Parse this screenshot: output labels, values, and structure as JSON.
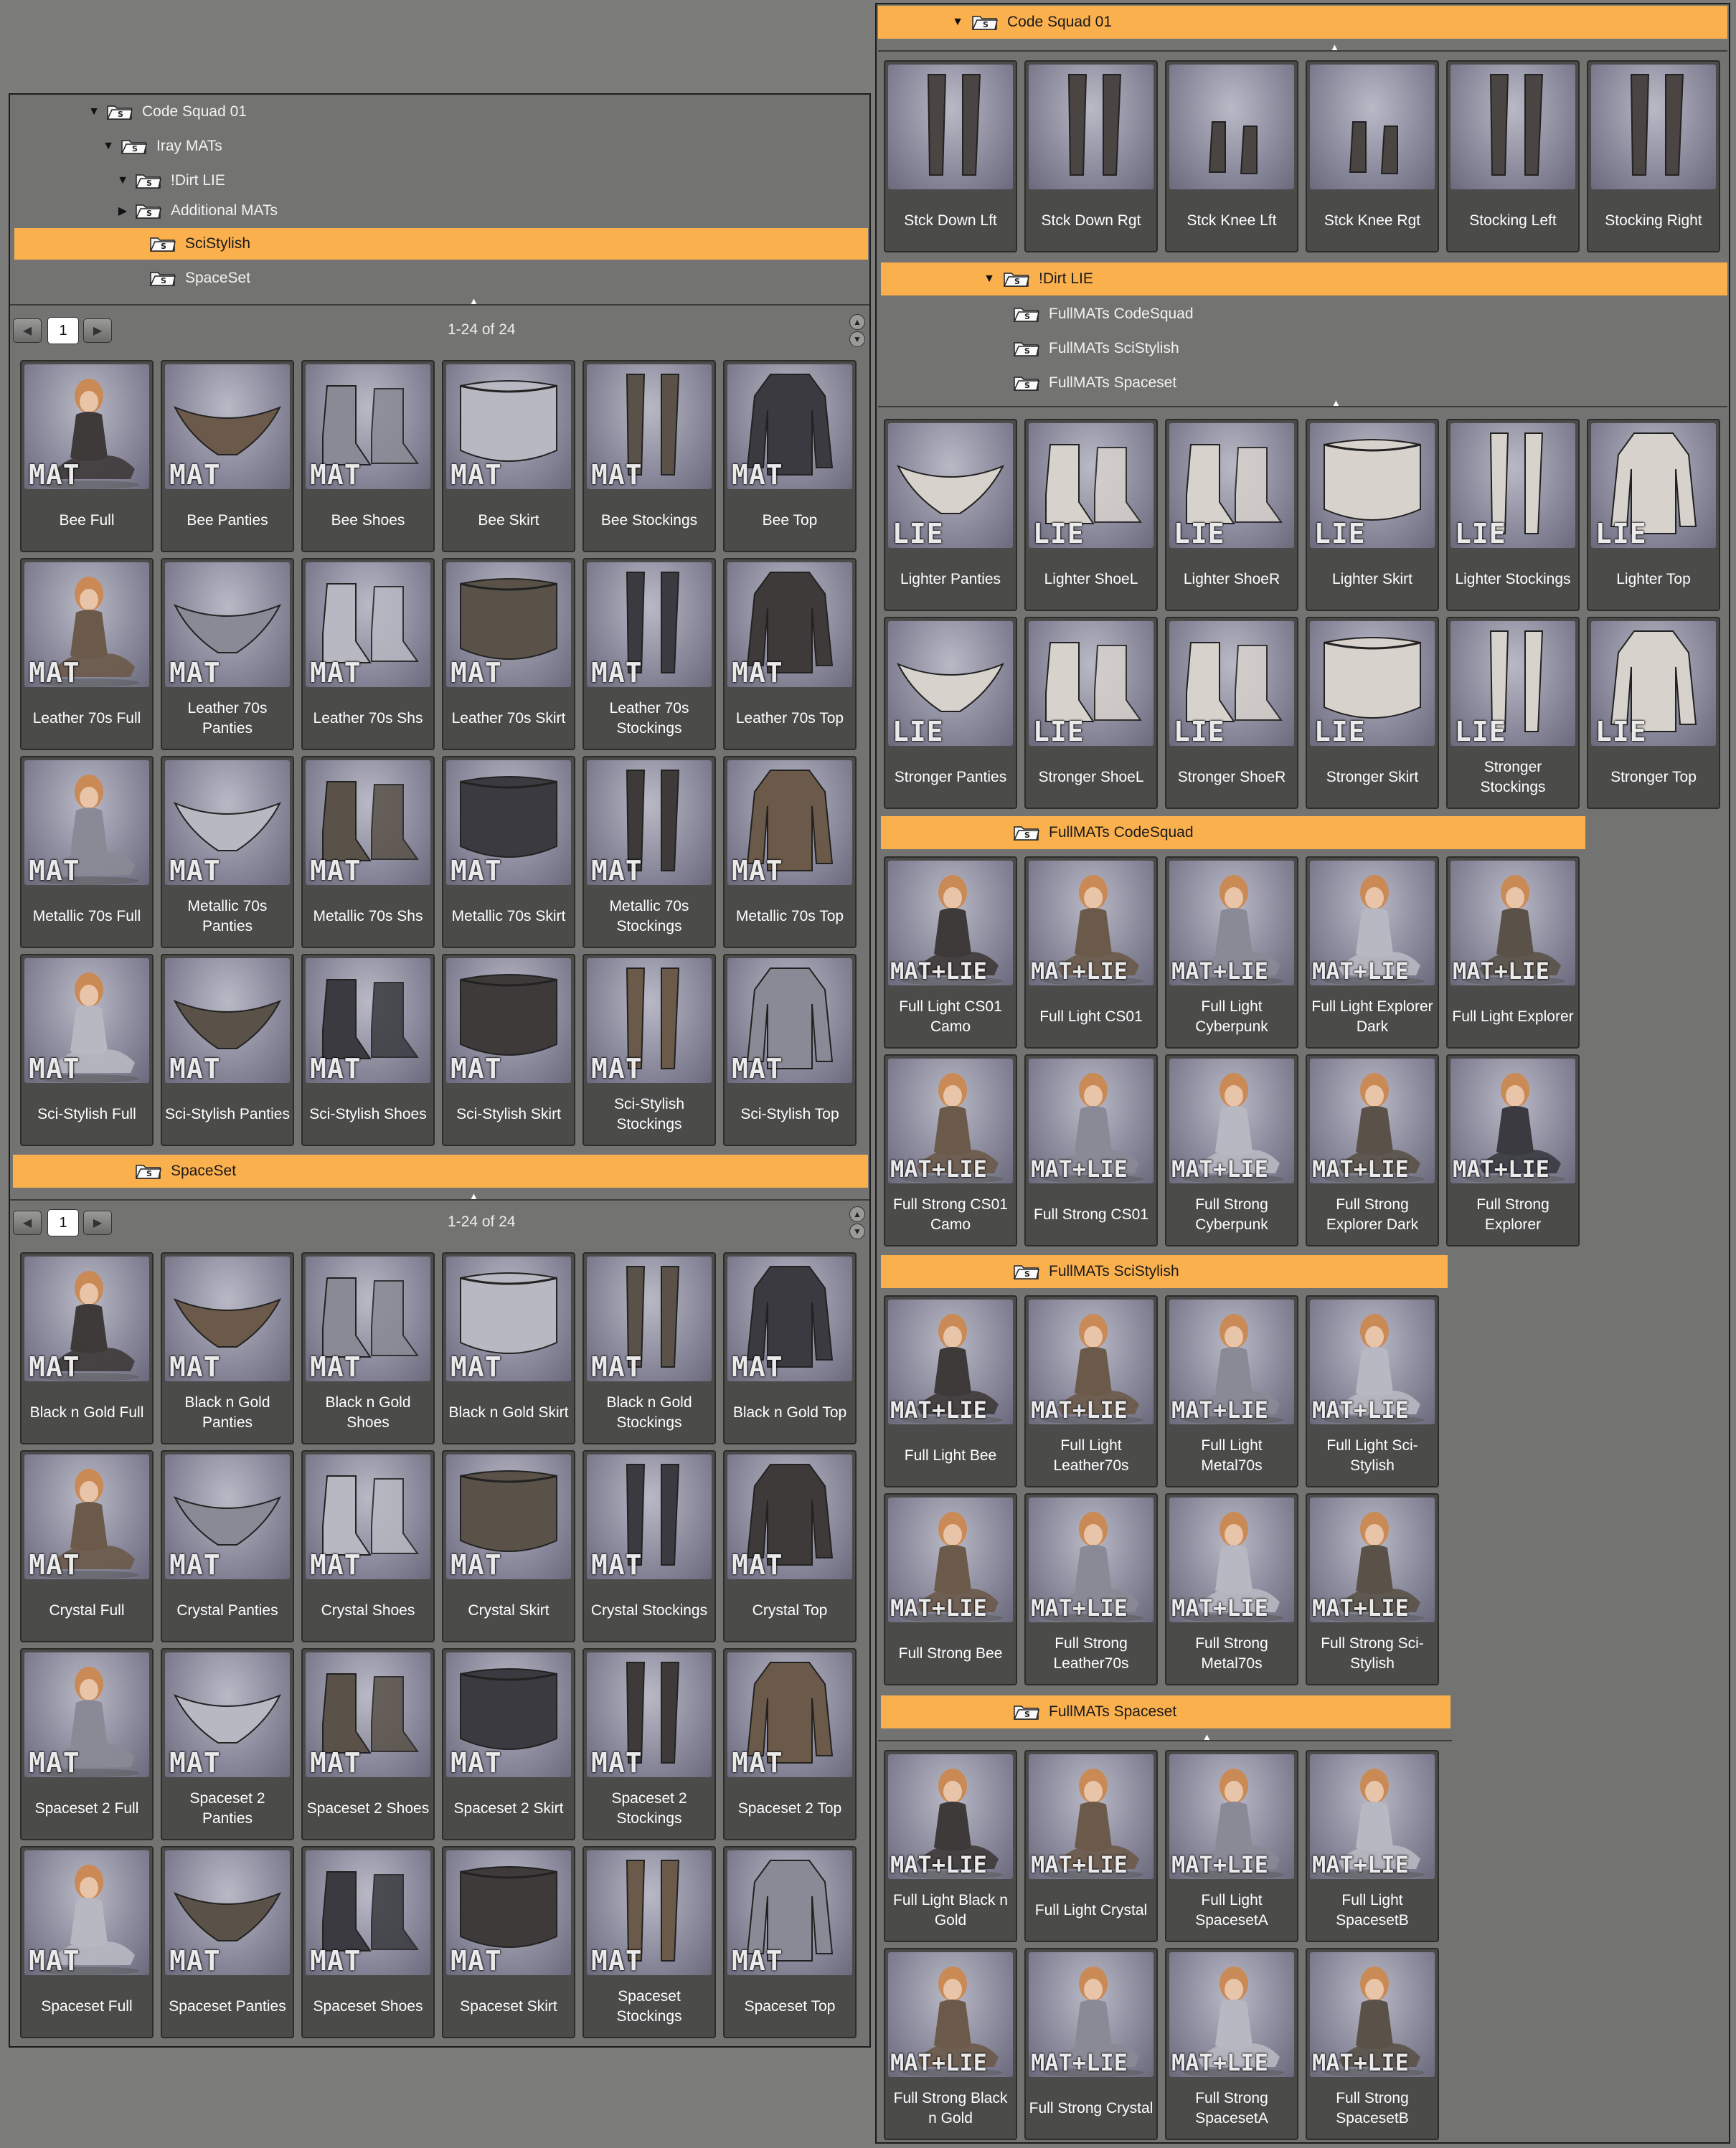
{
  "colors": {
    "accent": "#fbb04e",
    "panel": "#737371",
    "tile": "#4b4b4a"
  },
  "icons": {
    "folder": "smart-content-folder-icon",
    "expanded": "triangle-down-icon",
    "collapsed": "triangle-right-icon"
  },
  "left": {
    "tree": [
      {
        "label": "Code Squad 01",
        "state": "open"
      },
      {
        "label": "Iray MATs",
        "state": "open"
      },
      {
        "label": "!Dirt LIE",
        "state": "open"
      },
      {
        "label": "Additional MATs",
        "state": "closed"
      },
      {
        "label": "SciStylish",
        "state": "none",
        "selected": true
      },
      {
        "label": "SpaceSet",
        "state": "none"
      }
    ],
    "pager1": {
      "page": "1",
      "count": "1-24 of 24"
    },
    "grid1": [
      [
        "Bee Full",
        "Bee Panties",
        "Bee Shoes",
        "Bee Skirt",
        "Bee Stockings",
        "Bee Top"
      ],
      [
        "Leather 70s Full",
        "Leather 70s Panties",
        "Leather 70s Shs",
        "Leather 70s Skirt",
        "Leather 70s Stockings",
        "Leather 70s Top"
      ],
      [
        "Metallic 70s Full",
        "Metallic 70s Panties",
        "Metallic 70s Shs",
        "Metallic 70s Skirt",
        "Metallic 70s Stockings",
        "Metallic 70s Top"
      ],
      [
        "Sci-Stylish Full",
        "Sci-Stylish Panties",
        "Sci-Stylish Shoes",
        "Sci-Stylish Skirt",
        "Sci-Stylish Stockings",
        "Sci-Stylish Top"
      ]
    ],
    "header2": "SpaceSet",
    "pager2": {
      "page": "1",
      "count": "1-24 of 24"
    },
    "grid2": [
      [
        "Black n Gold Full",
        "Black n Gold Panties",
        "Black n Gold Shoes",
        "Black n Gold Skirt",
        "Black n Gold Stockings",
        "Black n Gold Top"
      ],
      [
        "Crystal Full",
        "Crystal Panties",
        "Crystal Shoes",
        "Crystal Skirt",
        "Crystal Stockings",
        "Crystal Top"
      ],
      [
        "Spaceset 2 Full",
        "Spaceset 2 Panties",
        "Spaceset 2 Shoes",
        "Spaceset 2 Skirt",
        "Spaceset 2 Stockings",
        "Spaceset 2 Top"
      ],
      [
        "Spaceset Full",
        "Spaceset Panties",
        "Spaceset Shoes",
        "Spaceset Skirt",
        "Spaceset Stockings",
        "Spaceset Top"
      ]
    ],
    "badge": "MAT"
  },
  "right": {
    "header1": "Code Squad 01",
    "grid1": [
      "Stck Down Lft",
      "Stck Down Rgt",
      "Stck Knee Lft",
      "Stck Knee Rgt",
      "Stocking Left",
      "Stocking Right"
    ],
    "header2": "!Dirt LIE",
    "subfolders": [
      "FullMATs CodeSquad",
      "FullMATs SciStylish",
      "FullMATs Spaceset"
    ],
    "lie_badge": "LIE",
    "lie_grid": [
      [
        "Lighter Panties",
        "Lighter ShoeL",
        "Lighter ShoeR",
        "Lighter Skirt",
        "Lighter Stockings",
        "Lighter Top"
      ],
      [
        "Stronger Panties",
        "Stronger ShoeL",
        "Stronger ShoeR",
        "Stronger Skirt",
        "Stronger Stockings",
        "Stronger Top"
      ]
    ],
    "matlie_badge": "MAT+LIE",
    "codesquad": {
      "header": "FullMATs CodeSquad",
      "rows": [
        [
          "Full Light CS01 Camo",
          "Full Light CS01",
          "Full Light Cyberpunk",
          "Full Light Explorer Dark",
          "Full Light Explorer"
        ],
        [
          "Full Strong CS01 Camo",
          "Full Strong CS01",
          "Full Strong Cyberpunk",
          "Full Strong Explorer Dark",
          "Full Strong Explorer"
        ]
      ]
    },
    "scistylish": {
      "header": "FullMATs SciStylish",
      "rows": [
        [
          "Full Light Bee",
          "Full Light Leather70s",
          "Full Light Metal70s",
          "Full Light Sci-Stylish"
        ],
        [
          "Full Strong Bee",
          "Full Strong Leather70s",
          "Full Strong Metal70s",
          "Full Strong Sci-Stylish"
        ]
      ]
    },
    "spaceset": {
      "header": "FullMATs Spaceset",
      "rows": [
        [
          "Full Light Black n Gold",
          "Full Light Crystal",
          "Full Light SpacesetA",
          "Full Light SpacesetB"
        ],
        [
          "Full Strong Black n Gold",
          "Full Strong Crystal",
          "Full Strong SpacesetA",
          "Full Strong SpacesetB"
        ]
      ]
    }
  }
}
